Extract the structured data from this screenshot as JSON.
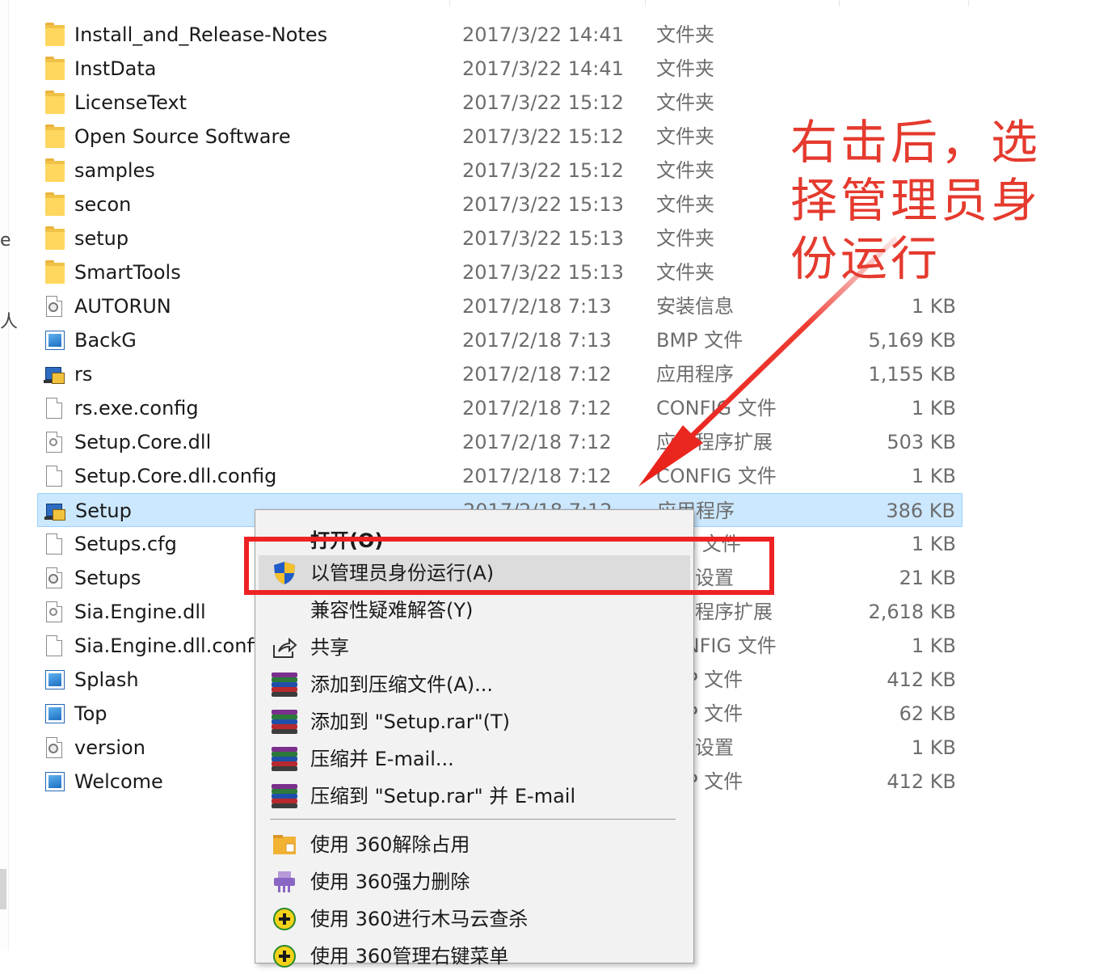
{
  "files": [
    {
      "name": "Install_and_Release-Notes",
      "date": "2017/3/22 14:41",
      "type": "文件夹",
      "size": "",
      "icon": "folder-icon"
    },
    {
      "name": "InstData",
      "date": "2017/3/22 14:41",
      "type": "文件夹",
      "size": "",
      "icon": "folder-icon"
    },
    {
      "name": "LicenseText",
      "date": "2017/3/22 15:12",
      "type": "文件夹",
      "size": "",
      "icon": "folder-icon"
    },
    {
      "name": "Open Source Software",
      "date": "2017/3/22 15:12",
      "type": "文件夹",
      "size": "",
      "icon": "folder-icon"
    },
    {
      "name": "samples",
      "date": "2017/3/22 15:12",
      "type": "文件夹",
      "size": "",
      "icon": "folder-icon"
    },
    {
      "name": "secon",
      "date": "2017/3/22 15:13",
      "type": "文件夹",
      "size": "",
      "icon": "folder-icon"
    },
    {
      "name": "setup",
      "date": "2017/3/22 15:13",
      "type": "文件夹",
      "size": "",
      "icon": "folder-icon"
    },
    {
      "name": "SmartTools",
      "date": "2017/3/22 15:13",
      "type": "文件夹",
      "size": "",
      "icon": "folder-icon"
    },
    {
      "name": "AUTORUN",
      "date": "2017/2/18 7:13",
      "type": "安装信息",
      "size": "1 KB",
      "icon": "settings-file-icon"
    },
    {
      "name": "BackG",
      "date": "2017/2/18 7:13",
      "type": "BMP 文件",
      "size": "5,169 KB",
      "icon": "image-file-icon"
    },
    {
      "name": "rs",
      "date": "2017/2/18 7:12",
      "type": "应用程序",
      "size": "1,155 KB",
      "icon": "installer-exe-icon"
    },
    {
      "name": "rs.exe.config",
      "date": "2017/2/18 7:12",
      "type": "CONFIG 文件",
      "size": "1 KB",
      "icon": "blank-file-icon"
    },
    {
      "name": "Setup.Core.dll",
      "date": "2017/2/18 7:12",
      "type": "应用程序扩展",
      "size": "503 KB",
      "icon": "dll-file-icon"
    },
    {
      "name": "Setup.Core.dll.config",
      "date": "2017/2/18 7:12",
      "type": "CONFIG 文件",
      "size": "1 KB",
      "icon": "blank-file-icon"
    },
    {
      "name": "Setup",
      "date": "2017/2/18 7:12",
      "type": "应用程序",
      "size": "386 KB",
      "icon": "installer-exe-icon",
      "selected": true
    },
    {
      "name": "Setups.cfg",
      "date": "",
      "type": "CFG 文件",
      "size": "1 KB",
      "icon": "blank-file-icon"
    },
    {
      "name": "Setups",
      "date": "",
      "type": "配置设置",
      "size": "21 KB",
      "icon": "settings-file-icon"
    },
    {
      "name": "Sia.Engine.dll",
      "date": "",
      "type": "应用程序扩展",
      "size": "2,618 KB",
      "icon": "dll-file-icon"
    },
    {
      "name": "Sia.Engine.dll.config",
      "date": "",
      "type": "CONFIG 文件",
      "size": "1 KB",
      "icon": "blank-file-icon"
    },
    {
      "name": "Splash",
      "date": "",
      "type": "BMP 文件",
      "size": "412 KB",
      "icon": "image-file-icon"
    },
    {
      "name": "Top",
      "date": "",
      "type": "BMP 文件",
      "size": "62 KB",
      "icon": "image-file-icon"
    },
    {
      "name": "version",
      "date": "",
      "type": "配置设置",
      "size": "1 KB",
      "icon": "settings-file-icon"
    },
    {
      "name": "Welcome",
      "date": "",
      "type": "BMP 文件",
      "size": "412 KB",
      "icon": "image-file-icon"
    }
  ],
  "context_menu": {
    "items": [
      {
        "label": "打开(O)",
        "icon": "",
        "bold": true
      },
      {
        "label": "以管理员身份运行(A)",
        "icon": "uac-shield-icon",
        "hover": true
      },
      {
        "label": "兼容性疑难解答(Y)",
        "icon": ""
      },
      {
        "label": "共享",
        "icon": "share-icon"
      },
      {
        "label": "添加到压缩文件(A)...",
        "icon": "winrar-icon"
      },
      {
        "label": "添加到 \"Setup.rar\"(T)",
        "icon": "winrar-icon"
      },
      {
        "label": "压缩并 E-mail...",
        "icon": "winrar-icon"
      },
      {
        "label": "压缩到 \"Setup.rar\" 并 E-mail",
        "icon": "winrar-icon"
      },
      {
        "label": "使用 360解除占用",
        "icon": "360-unlock-icon"
      },
      {
        "label": "使用 360强力删除",
        "icon": "360-shred-icon"
      },
      {
        "label": "使用 360进行木马云查杀",
        "icon": "360-scan-icon"
      },
      {
        "label": "使用 360管理右键菜单",
        "icon": "360-menu-icon"
      }
    ]
  },
  "annotation": {
    "text": "右击后，选择管理员身份运行",
    "color": "#e53a2e"
  },
  "colors": {
    "selection": "#cce8ff",
    "highlight_box": "#ee2222",
    "folder": "#ffd75e"
  },
  "left_edge_fragments": [
    "e",
    "人"
  ]
}
